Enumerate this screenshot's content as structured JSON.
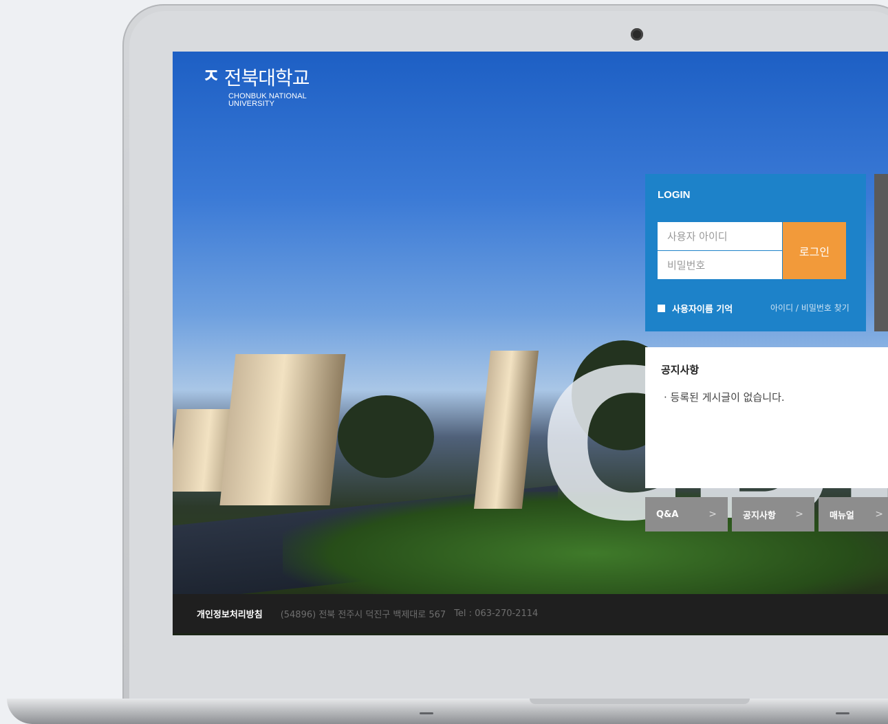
{
  "logo": {
    "name_ko": "전북대학교",
    "name_en_line1": "CHONBUK NATIONAL",
    "name_en_line2": "UNIVERSITY",
    "mark_icon": "chonbuk-logo-icon"
  },
  "login": {
    "title": "LOGIN",
    "id_placeholder": "사용자 아이디",
    "pw_placeholder": "비밀번호",
    "button_label": "로그인",
    "remember_label": "사용자이름 기억",
    "find_label": "아이디 / 비밀번호 찾기"
  },
  "notice": {
    "title": "공지사항",
    "empty_message": "· 등록된 게시글이 없습니다."
  },
  "quick_links": [
    {
      "label": "Q&A"
    },
    {
      "label": "공지사항"
    },
    {
      "label": "매뉴얼"
    }
  ],
  "footer": {
    "privacy": "개인정보처리방침",
    "address": "(54896) 전북 전주시 덕진구 백제대로 567",
    "tel": "Tel : 063-270-2114"
  },
  "colors": {
    "login_bg": "#1d82c9",
    "login_button": "#f29a3a",
    "footer_bg": "#1f1f1f"
  }
}
